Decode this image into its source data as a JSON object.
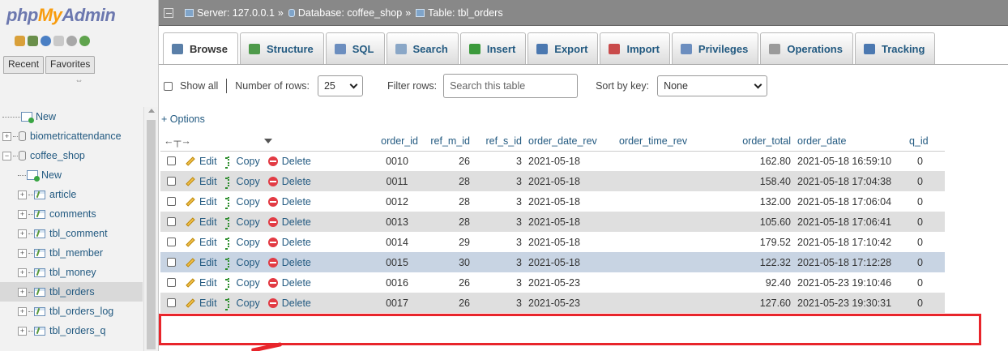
{
  "logo": {
    "php": "php",
    "my": "My",
    "admin": "Admin"
  },
  "sidebar": {
    "recent_label": "Recent",
    "favorites_label": "Favorites",
    "tree": [
      {
        "label": "New",
        "kind": "new",
        "level": 0
      },
      {
        "label": "biometricattendance",
        "kind": "db",
        "level": 0
      },
      {
        "label": "coffee_shop",
        "kind": "db-open",
        "level": 0
      },
      {
        "label": "New",
        "kind": "new",
        "level": 1
      },
      {
        "label": "article",
        "kind": "table",
        "level": 1
      },
      {
        "label": "comments",
        "kind": "table",
        "level": 1
      },
      {
        "label": "tbl_comment",
        "kind": "table",
        "level": 1
      },
      {
        "label": "tbl_member",
        "kind": "table",
        "level": 1
      },
      {
        "label": "tbl_money",
        "kind": "table",
        "level": 1
      },
      {
        "label": "tbl_orders",
        "kind": "table-selected",
        "level": 1
      },
      {
        "label": "tbl_orders_log",
        "kind": "table",
        "level": 1
      },
      {
        "label": "tbl_orders_q",
        "kind": "table",
        "level": 1
      }
    ]
  },
  "breadcrumb": {
    "server": "Server: 127.0.0.1",
    "database": "Database: coffee_shop",
    "table": "Table: tbl_orders",
    "separator": "»"
  },
  "tabs": [
    {
      "label": "Browse",
      "icon": "browse-icon",
      "color": "#5a7fa8"
    },
    {
      "label": "Structure",
      "icon": "structure-icon",
      "color": "#4e9a4a"
    },
    {
      "label": "SQL",
      "icon": "sql-icon",
      "color": "#6c8ebf"
    },
    {
      "label": "Search",
      "icon": "search-icon",
      "color": "#8aa7c7"
    },
    {
      "label": "Insert",
      "icon": "insert-icon",
      "color": "#3c9a3c"
    },
    {
      "label": "Export",
      "icon": "export-icon",
      "color": "#4b78b0"
    },
    {
      "label": "Import",
      "icon": "import-icon",
      "color": "#c94b4b"
    },
    {
      "label": "Privileges",
      "icon": "privileges-icon",
      "color": "#6c8ebf"
    },
    {
      "label": "Operations",
      "icon": "operations-icon",
      "color": "#9a9a9a"
    },
    {
      "label": "Tracking",
      "icon": "tracking-icon",
      "color": "#4b78b0"
    }
  ],
  "controls": {
    "show_all": "Show all",
    "number_of_rows_label": "Number of rows:",
    "number_of_rows_value": "25",
    "filter_rows_label": "Filter rows:",
    "filter_placeholder": "Search this table",
    "sort_by_key_label": "Sort by key:",
    "sort_by_key_value": "None"
  },
  "options_link": "+ Options",
  "table": {
    "columns": [
      "order_id",
      "ref_m_id",
      "ref_s_id",
      "order_date_rev",
      "order_time_rev",
      "order_total",
      "order_date",
      "q_id"
    ],
    "action_labels": {
      "edit": "Edit",
      "copy": "Copy",
      "delete": "Delete"
    },
    "rows": [
      {
        "order_id": "0010",
        "ref_m_id": "26",
        "ref_s_id": "3",
        "order_date_rev": "2021-05-18",
        "order_time_rev": "",
        "order_total": "162.80",
        "order_date": "2021-05-18 16:59:10",
        "q_id": "0"
      },
      {
        "order_id": "0011",
        "ref_m_id": "28",
        "ref_s_id": "3",
        "order_date_rev": "2021-05-18",
        "order_time_rev": "",
        "order_total": "158.40",
        "order_date": "2021-05-18 17:04:38",
        "q_id": "0"
      },
      {
        "order_id": "0012",
        "ref_m_id": "28",
        "ref_s_id": "3",
        "order_date_rev": "2021-05-18",
        "order_time_rev": "",
        "order_total": "132.00",
        "order_date": "2021-05-18 17:06:04",
        "q_id": "0"
      },
      {
        "order_id": "0013",
        "ref_m_id": "28",
        "ref_s_id": "3",
        "order_date_rev": "2021-05-18",
        "order_time_rev": "",
        "order_total": "105.60",
        "order_date": "2021-05-18 17:06:41",
        "q_id": "0"
      },
      {
        "order_id": "0014",
        "ref_m_id": "29",
        "ref_s_id": "3",
        "order_date_rev": "2021-05-18",
        "order_time_rev": "",
        "order_total": "179.52",
        "order_date": "2021-05-18 17:10:42",
        "q_id": "0"
      },
      {
        "order_id": "0015",
        "ref_m_id": "30",
        "ref_s_id": "3",
        "order_date_rev": "2021-05-18",
        "order_time_rev": "",
        "order_total": "122.32",
        "order_date": "2021-05-18 17:12:28",
        "q_id": "0"
      },
      {
        "order_id": "0016",
        "ref_m_id": "26",
        "ref_s_id": "3",
        "order_date_rev": "2021-05-23",
        "order_time_rev": "",
        "order_total": "92.40",
        "order_date": "2021-05-23 19:10:46",
        "q_id": "0"
      },
      {
        "order_id": "0017",
        "ref_m_id": "26",
        "ref_s_id": "3",
        "order_date_rev": "2021-05-23",
        "order_time_rev": "",
        "order_total": "127.60",
        "order_date": "2021-05-23 19:30:31",
        "q_id": "0"
      }
    ]
  },
  "colors": {
    "highlight": "#e8252b",
    "link": "#235a81",
    "row_alt": "#dfdfdf",
    "row_hover": "#c8d4e3"
  }
}
